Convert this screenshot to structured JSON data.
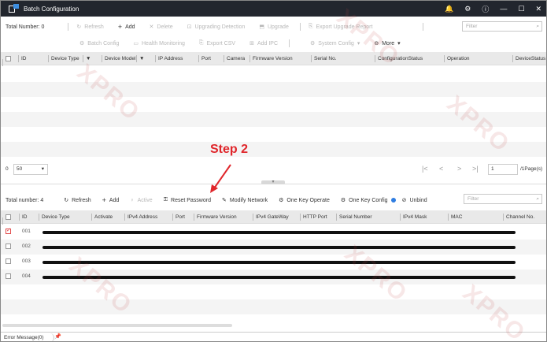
{
  "window": {
    "title": "Batch Configuration",
    "controls": [
      "🔔",
      "⚙",
      "ⓘ",
      "—",
      "☐",
      "✕"
    ]
  },
  "top_toolbar": {
    "total_label": "Total Number: 0",
    "refresh": "Refresh",
    "add": "Add",
    "delete": "Delete",
    "upgrading_detection": "Upgrading Detection",
    "upgrade": "Upgrade",
    "export_upgrade_report": "Export Upgrade Report",
    "filter_placeholder": "Filter"
  },
  "top_toolbar2": {
    "batch_config": "Batch Config",
    "health_monitoring": "Health Monitoring",
    "export_csv": "Export CSV",
    "add_ipc": "Add IPC",
    "system_config": "System Config",
    "more": "More"
  },
  "top_table": {
    "columns": [
      "ID",
      "Device Type",
      "Device Model",
      "IP Address",
      "Port",
      "Camera",
      "Firmware Version",
      "Serial No.",
      "ConfigurationStatus",
      "Operation",
      "DeviceStatus"
    ]
  },
  "pager": {
    "page_size": "50",
    "page_input": "1",
    "page_total": "/1Page(s)"
  },
  "annotation": {
    "step": "Step 2"
  },
  "bottom_toolbar": {
    "total_label": "Total number: 4",
    "refresh": "Refresh",
    "add": "Add",
    "active": "Active",
    "reset_password": "Reset Password",
    "modify_network": "Modify Network",
    "one_key_operate": "One Key Operate",
    "one_key_config": "One Key Config",
    "unbind": "Unbind",
    "filter_placeholder": "Filter"
  },
  "bottom_table": {
    "columns": [
      "ID",
      "Device Type",
      "Activate",
      "IPv4 Address",
      "Port",
      "Firmware Version",
      "IPv4 GateWay",
      "HTTP Port",
      "Serial Number",
      "IPv4 Mask",
      "MAC",
      "Channel No."
    ],
    "rows": [
      {
        "id": "001",
        "checked": true
      },
      {
        "id": "002",
        "checked": false
      },
      {
        "id": "003",
        "checked": false
      },
      {
        "id": "004",
        "checked": false
      }
    ]
  },
  "status_bar": {
    "error_message": "Error Message(0)"
  },
  "watermark": "XPRO"
}
